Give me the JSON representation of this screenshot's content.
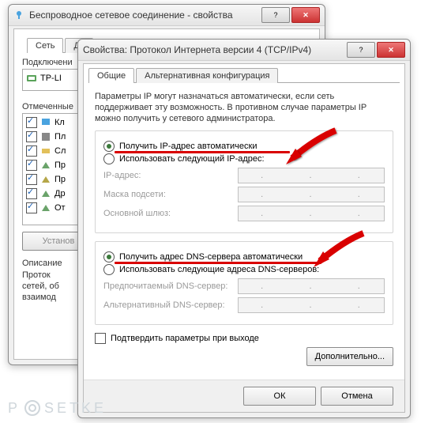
{
  "bg_window": {
    "title": "Беспроводное сетевое соединение - свойства",
    "tabs": [
      "Сеть",
      "До"
    ],
    "connect_label": "Подключени",
    "adapter_label": "TP-LI",
    "components_label": "Отмеченные",
    "items": [
      {
        "label": "Кл"
      },
      {
        "label": "Пл"
      },
      {
        "label": "Сл"
      },
      {
        "label": "Пр"
      },
      {
        "label": "Пр"
      },
      {
        "label": "Др"
      },
      {
        "label": "От"
      }
    ],
    "install_button": "Установ",
    "desc_label": "Описание",
    "desc_text": "Проток\nсетей, об\nвзаимод"
  },
  "dialog": {
    "title": "Свойства: Протокол Интернета версии 4 (TCP/IPv4)",
    "tabs": {
      "general": "Общие",
      "alt": "Альтернативная конфигурация"
    },
    "intro": "Параметры IP могут назначаться автоматически, если сеть поддерживает эту возможность. В противном случае параметры IP можно получить у сетевого администратора.",
    "ip_auto": "Получить IP-адрес автоматически",
    "ip_manual": "Использовать следующий IP-адрес:",
    "ip_label": "IP-адрес:",
    "mask_label": "Маска подсети:",
    "gw_label": "Основной шлюз:",
    "dns_auto": "Получить адрес DNS-сервера автоматически",
    "dns_manual": "Использовать следующие адреса DNS-серверов:",
    "dns1_label": "Предпочитаемый DNS-сервер:",
    "dns2_label": "Альтернативный DNS-сервер:",
    "confirm_exit": "Подтвердить параметры при выходе",
    "advanced": "Дополнительно...",
    "ok": "ОК",
    "cancel": "Отмена"
  },
  "colors": {
    "accent_red": "#d90000"
  },
  "watermark": "P  SETKE"
}
